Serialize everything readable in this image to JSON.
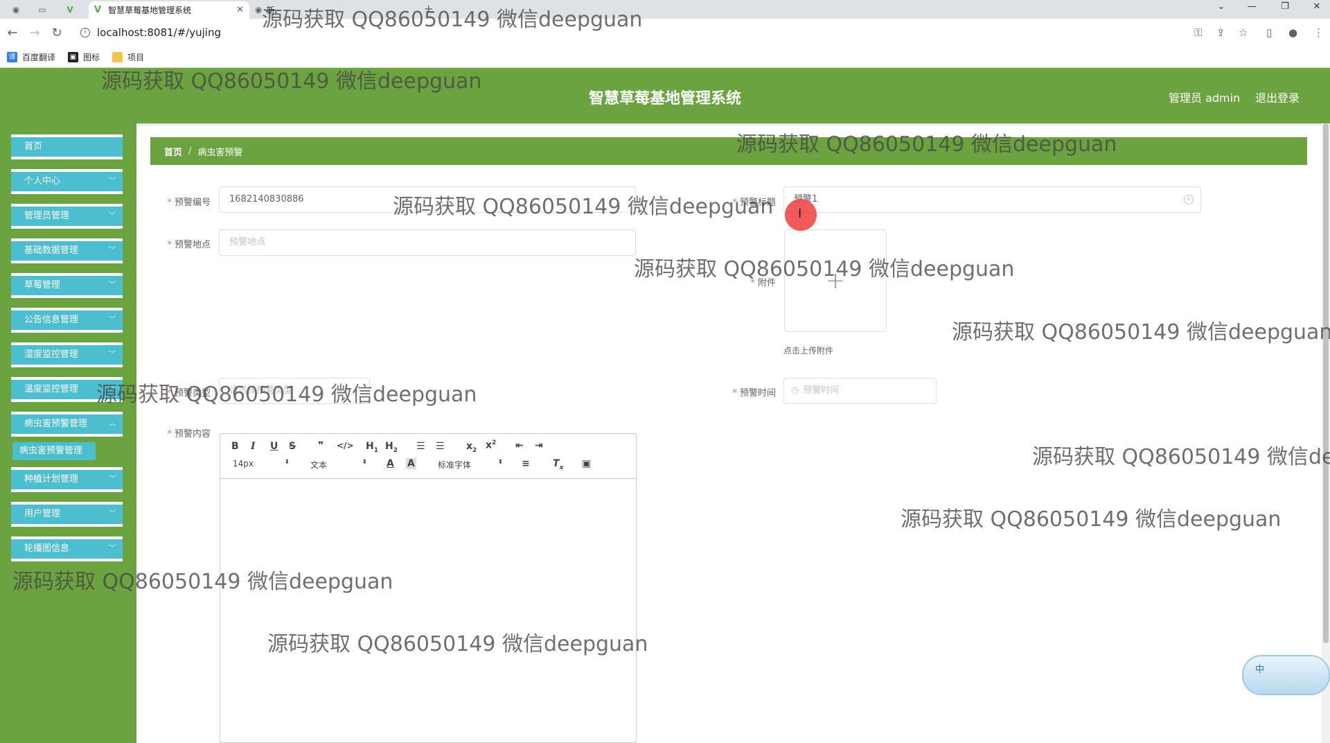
{
  "browser": {
    "tabs": [
      {
        "title": "智慧草莓基地管理系统",
        "active": true
      },
      {
        "title": "新",
        "active": false
      }
    ],
    "url": "localhost:8081/#/yujing",
    "bookmarks": [
      {
        "label": "百度翻译",
        "icon": "translate-icon"
      },
      {
        "label": "图标",
        "icon": "image-icon"
      },
      {
        "label": "项目",
        "icon": "folder-icon"
      }
    ]
  },
  "header": {
    "title": "智慧草莓基地管理系统",
    "user": "管理员 admin",
    "logout": "退出登录",
    "color": "#6ba33f"
  },
  "sidebar": {
    "accent": "#4bbfd0",
    "items": [
      {
        "label": "首页"
      },
      {
        "label": "个人中心"
      },
      {
        "label": "管理员管理"
      },
      {
        "label": "基础数据管理"
      },
      {
        "label": "草莓管理"
      },
      {
        "label": "公告信息管理"
      },
      {
        "label": "湿度监控管理"
      },
      {
        "label": "温度监控管理"
      },
      {
        "label": "病虫害预警管理"
      },
      {
        "label": "种植计划管理"
      },
      {
        "label": "用户管理"
      },
      {
        "label": "轮播图信息"
      }
    ],
    "submenu": "病虫害预警管理"
  },
  "breadcrumb": {
    "home": "首页",
    "current": "病虫害预警"
  },
  "form": {
    "code_label": "预警编号",
    "code_value": "1682140830886",
    "title_label": "预警标题",
    "title_value": "预警1",
    "location_label": "预警地点",
    "location_placeholder": "预警地点",
    "attachment_label": "附件",
    "attachment_tip": "点击上传附件",
    "type_label": "预警类型",
    "type_placeholder": "请选择预警类型",
    "time_label": "预警时间",
    "time_placeholder": "预警时间",
    "content_label": "预警内容"
  },
  "editor": {
    "font_size": "14px",
    "header_select": "文本",
    "font_family": "标准字体"
  },
  "ime": {
    "char": "中"
  },
  "watermark": "源码获取 QQ86050149 微信deepguan"
}
